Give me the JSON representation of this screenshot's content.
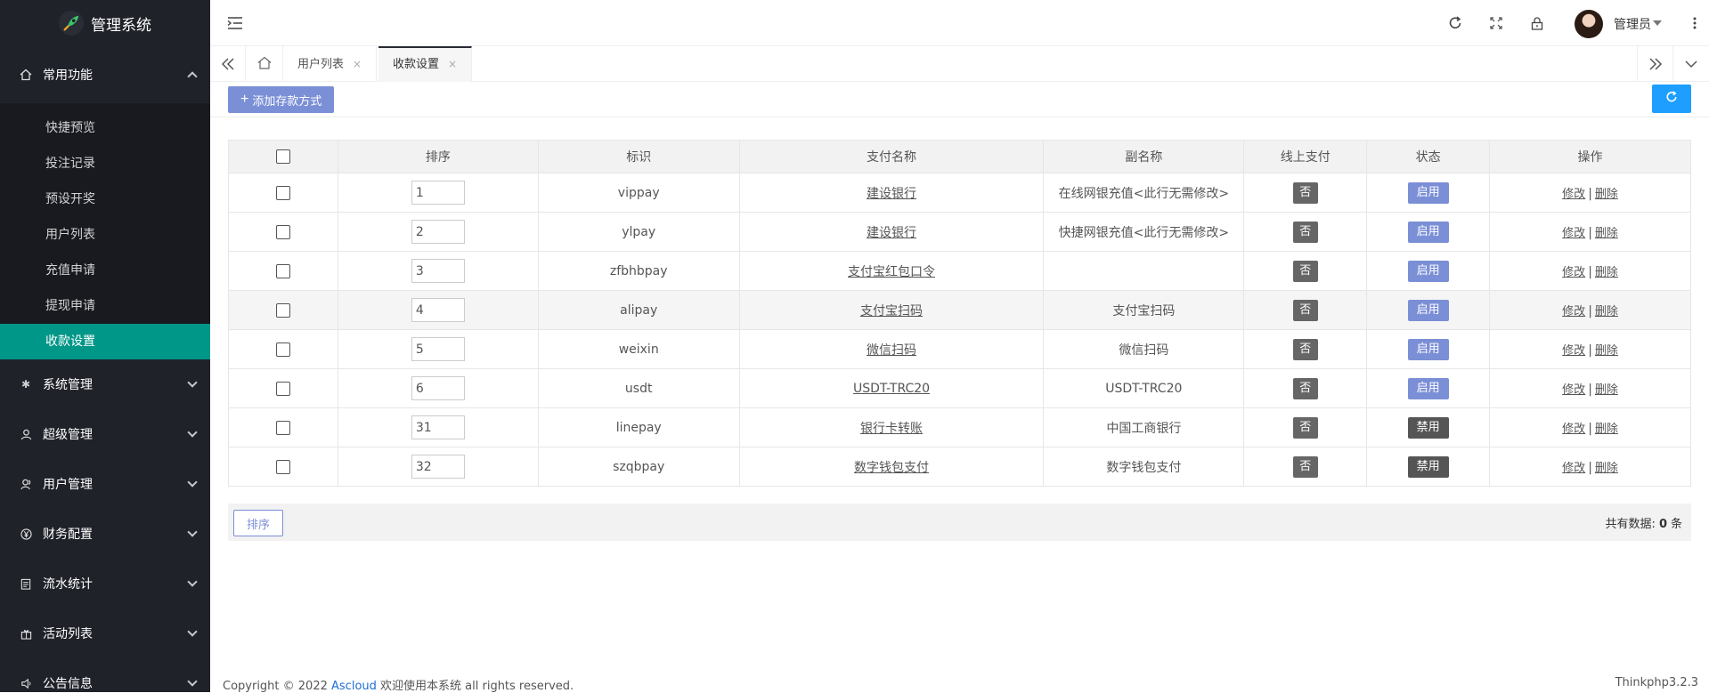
{
  "app": {
    "title": "管理系统"
  },
  "sidebar": {
    "groups": [
      {
        "label": "常用功能",
        "icon": "home-icon",
        "expanded": true,
        "items": [
          "快捷预览",
          "投注记录",
          "预设开奖",
          "用户列表",
          "充值申请",
          "提现申请",
          "收款设置"
        ],
        "active_item": "收款设置"
      },
      {
        "label": "系统管理",
        "icon": "gear-icon"
      },
      {
        "label": "超级管理",
        "icon": "user-icon"
      },
      {
        "label": "用户管理",
        "icon": "users-icon"
      },
      {
        "label": "财务配置",
        "icon": "yen-icon"
      },
      {
        "label": "流水统计",
        "icon": "clipboard-icon"
      },
      {
        "label": "活动列表",
        "icon": "gift-icon"
      },
      {
        "label": "公告信息",
        "icon": "speaker-icon"
      }
    ]
  },
  "header": {
    "username": "管理员"
  },
  "tabs": [
    {
      "label": "用户列表",
      "close": "×"
    },
    {
      "label": "收款设置",
      "close": "×",
      "active": true
    }
  ],
  "toolbar": {
    "add_label": "添加存款方式"
  },
  "table": {
    "columns": [
      "排序",
      "标识",
      "支付名称",
      "副名称",
      "线上支付",
      "状态",
      "操作"
    ],
    "rows": [
      {
        "sort": "1",
        "code": "vippay",
        "name": "建设银行",
        "subname": "在线网银充值<此行无需修改>",
        "online": "否",
        "status": "启用",
        "status_on": true
      },
      {
        "sort": "2",
        "code": "ylpay",
        "name": "建设银行",
        "subname": "快捷网银充值<此行无需修改>",
        "online": "否",
        "status": "启用",
        "status_on": true
      },
      {
        "sort": "3",
        "code": "zfbhbpay",
        "name": "支付宝红包口令",
        "subname": "",
        "online": "否",
        "status": "启用",
        "status_on": true
      },
      {
        "sort": "4",
        "code": "alipay",
        "name": "支付宝扫码",
        "subname": "支付宝扫码",
        "online": "否",
        "status": "启用",
        "status_on": true
      },
      {
        "sort": "5",
        "code": "weixin",
        "name": "微信扫码",
        "subname": "微信扫码",
        "online": "否",
        "status": "启用",
        "status_on": true
      },
      {
        "sort": "6",
        "code": "usdt",
        "name": "USDT-TRC20",
        "subname": "USDT-TRC20",
        "online": "否",
        "status": "启用",
        "status_on": true
      },
      {
        "sort": "31",
        "code": "linepay",
        "name": "银行卡转账",
        "subname": "中国工商银行",
        "online": "否",
        "status": "禁用",
        "status_on": false
      },
      {
        "sort": "32",
        "code": "szqbpay",
        "name": "数字钱包支付",
        "subname": "数字钱包支付",
        "online": "否",
        "status": "禁用",
        "status_on": false
      }
    ],
    "edit_label": "修改",
    "delete_label": "删除",
    "sep": "|"
  },
  "footer_bar": {
    "sort_label": "排序",
    "total_prefix": "共有数据:",
    "total_count": "0",
    "total_suffix": "条"
  },
  "footer": {
    "copyright_prefix": "Copyright © 2022",
    "brand": "Ascloud",
    "copyright_suffix": "欢迎使用本系统 all rights reserved.",
    "version": "Thinkphp3.2.3"
  },
  "colors": {
    "sidebar_bg": "#20222a",
    "active_green": "#009688",
    "accent_purple": "#7b8fd6",
    "refresh_blue": "#1e9fff"
  }
}
